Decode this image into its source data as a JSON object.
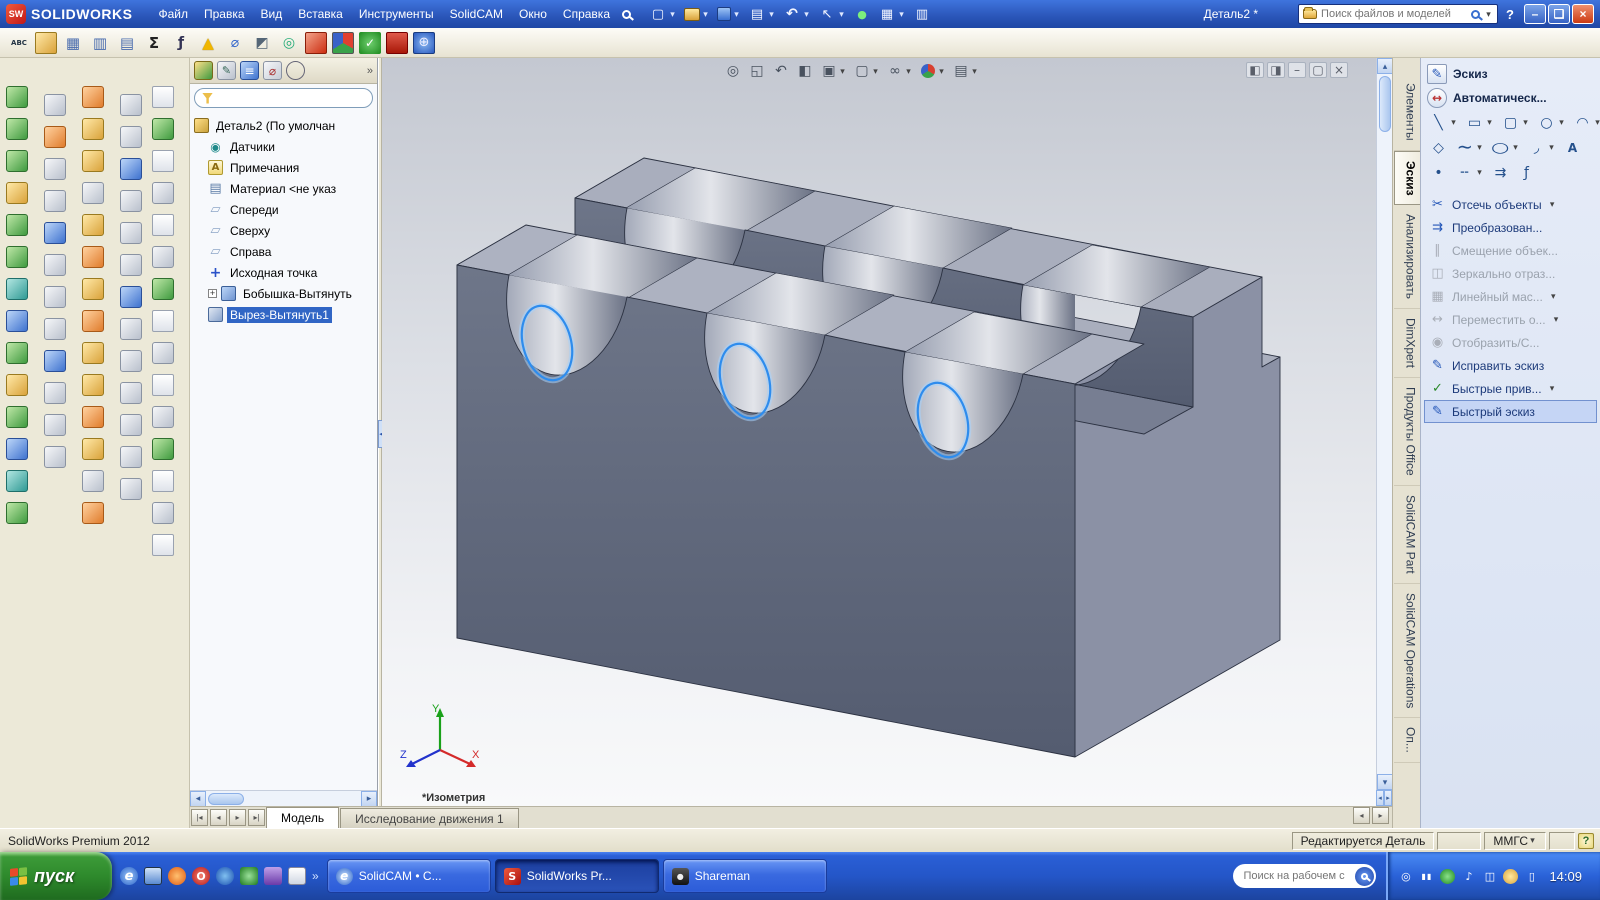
{
  "window": {
    "brand": "SOLIDWORKS",
    "title": "Деталь2 *",
    "files_search_placeholder": "Поиск файлов и моделей"
  },
  "menubar": {
    "items": [
      "Файл",
      "Правка",
      "Вид",
      "Вставка",
      "Инструменты",
      "SolidCAM",
      "Окно",
      "Справка"
    ],
    "tool_icons": [
      {
        "icon": "new-document",
        "dropdown": true
      },
      {
        "icon": "open",
        "dropdown": true
      },
      {
        "icon": "save",
        "dropdown": true
      },
      {
        "icon": "print",
        "dropdown": true
      },
      {
        "icon": "undo",
        "dropdown": true
      },
      {
        "icon": "select",
        "dropdown": true
      },
      {
        "icon": "rebuild",
        "dropdown": false
      },
      {
        "icon": "options",
        "dropdown": true
      },
      {
        "icon": "file-properties",
        "dropdown": false
      }
    ]
  },
  "toolbar2": {
    "icons": [
      "spellcheck",
      "design-library",
      "grid-system",
      "hole-table",
      "bom",
      "sigma",
      "equations",
      "warning",
      "measure",
      "section-props",
      "sensor2",
      "solidcam-simulate",
      "solidcam-tool",
      "solidcam-check",
      "solidcam-stop",
      "solidcam-web"
    ]
  },
  "left_dock": {
    "columns": [
      [
        "g",
        "g",
        "g",
        "y",
        "g",
        "g",
        "t",
        "b",
        "g",
        "y",
        "g",
        "b",
        "t",
        "g"
      ],
      [
        "gr",
        "o",
        "gr",
        "gr",
        "b",
        "gr",
        "gr",
        "gr",
        "b",
        "gr",
        "gr",
        "gr"
      ],
      [
        "o",
        "y",
        "y",
        "gr",
        "y",
        "o",
        "y",
        "o",
        "y",
        "y",
        "o",
        "y",
        "gr",
        "o"
      ],
      [
        "gr",
        "gr",
        "b",
        "gr",
        "gr",
        "gr",
        "b",
        "gr",
        "gr",
        "gr",
        "gr",
        "gr",
        "gr"
      ],
      [
        "w",
        "g",
        "w",
        "gr",
        "w",
        "gr",
        "g",
        "w",
        "gr",
        "w",
        "gr",
        "g",
        "w",
        "gr",
        "w"
      ]
    ]
  },
  "feature_manager": {
    "tabs": [
      {
        "icon": "featuremanager"
      },
      {
        "icon": "propertymanager"
      },
      {
        "icon": "configurationmanager"
      },
      {
        "icon": "dimxpertmanager"
      },
      {
        "icon": "displaymanager"
      }
    ],
    "tree": [
      {
        "label": "Деталь2  (По умолчан",
        "icon": "part"
      },
      {
        "label": "Датчики",
        "icon": "sensors",
        "lvl1": true
      },
      {
        "label": "Примечания",
        "icon": "annotations",
        "lvl1": true
      },
      {
        "label": "Материал <не указ",
        "icon": "material",
        "lvl1": true
      },
      {
        "label": "Спереди",
        "icon": "plane",
        "lvl1": true
      },
      {
        "label": "Сверху",
        "icon": "plane",
        "lvl1": true
      },
      {
        "label": "Справа",
        "icon": "plane",
        "lvl1": true
      },
      {
        "label": "Исходная точка",
        "icon": "origin",
        "lvl1": true
      },
      {
        "label": "Бобышка-Вытянуть",
        "icon": "boss-extrude",
        "lvl1": true,
        "expand": true
      },
      {
        "label": "Вырез-Вытянуть1",
        "icon": "cut-extrude",
        "lvl1": true,
        "selected": true
      }
    ]
  },
  "viewport": {
    "view_label": "*Изометрия",
    "triad": {
      "x": "X",
      "y": "Y",
      "z": "Z"
    },
    "headsup": [
      {
        "icon": "zoom-fit"
      },
      {
        "icon": "zoom-area"
      },
      {
        "icon": "previous-view"
      },
      {
        "icon": "section-view"
      },
      {
        "icon": "view-orientation",
        "dropdown": true
      },
      {
        "icon": "display-style",
        "dropdown": true
      },
      {
        "icon": "hide-show-items",
        "dropdown": true
      },
      {
        "icon": "edit-appearance",
        "dropdown": true
      },
      {
        "icon": "apply-scene",
        "dropdown": true
      }
    ],
    "window_buttons": [
      {
        "icon": "split-horizontal"
      },
      {
        "icon": "split-vertical"
      },
      {
        "icon": "minimize"
      },
      {
        "icon": "restore"
      },
      {
        "icon": "close-x"
      }
    ]
  },
  "bottom_tabs": {
    "nav": [
      {
        "icon": "first"
      },
      {
        "icon": "prev"
      },
      {
        "icon": "next"
      },
      {
        "icon": "last"
      }
    ],
    "tabs": [
      {
        "label": "Модель",
        "active": true
      },
      {
        "label": "Исследование движения 1"
      }
    ]
  },
  "statusbar": {
    "left": "SolidWorks Premium 2012",
    "editing": "Редактируется Деталь",
    "units": "ММГС",
    "help": "?"
  },
  "command_manager": {
    "tabs": [
      {
        "label": "Элементы"
      },
      {
        "label": "Эскиз",
        "active": true
      },
      {
        "label": "Анализировать"
      },
      {
        "label": "DimXpert"
      },
      {
        "label": "Продукты Office"
      },
      {
        "label": "SolidCAM Part"
      },
      {
        "label": "SolidCAM Operations"
      },
      {
        "label": "Оп..."
      }
    ],
    "primary": [
      {
        "label": "Эскиз",
        "icon": "sketch"
      },
      {
        "label": "Автоматическ...",
        "icon": "smart-dimension"
      }
    ],
    "grid_row1": [
      {
        "icon": "line",
        "dropdown": true
      },
      {
        "icon": "corner-rectangle",
        "dropdown": true
      },
      {
        "icon": "straight-slot",
        "dropdown": true
      },
      {
        "icon": "circle",
        "dropdown": true
      },
      {
        "icon": "centerpoint-arc",
        "dropdown": true
      }
    ],
    "grid_row2": [
      {
        "icon": "polygon"
      },
      {
        "icon": "spline",
        "dropdown": true
      },
      {
        "icon": "ellipse",
        "dropdown": true
      },
      {
        "icon": "sketch-fillet",
        "dropdown": true
      },
      {
        "icon": "text"
      }
    ],
    "grid_row3": [
      {
        "icon": "point"
      },
      {
        "icon": "centerline",
        "dropdown": true
      },
      {
        "icon": "convert-entities"
      },
      {
        "icon": "equation"
      }
    ],
    "tools": [
      {
        "label": "Отсечь объекты",
        "icon": "trim",
        "dropdown": true
      },
      {
        "label": "Преобразован...",
        "icon": "convert"
      },
      {
        "label": "Смещение объек...",
        "icon": "offset",
        "disabled": true
      },
      {
        "label": "Зеркально отраз...",
        "icon": "mirror",
        "disabled": true
      },
      {
        "label": "Линейный мас...",
        "icon": "linear-pattern",
        "disabled": true,
        "dropdown": true
      },
      {
        "label": "Переместить о...",
        "icon": "move",
        "disabled": true,
        "dropdown": true
      },
      {
        "label": "Отобразить/С...",
        "icon": "show-hide",
        "disabled": true
      },
      {
        "label": "Исправить эскиз",
        "icon": "repair"
      },
      {
        "label": "Быстрые прив...",
        "icon": "quick-snaps",
        "dropdown": true
      },
      {
        "label": "Быстрый эскиз",
        "icon": "quick-sketch",
        "selected": true
      }
    ]
  },
  "taskbar": {
    "start": "пуск",
    "quick_launch": [
      "ie",
      "desktop",
      "firefox",
      "opera",
      "media",
      "green-app",
      "purple-app",
      "doc-app"
    ],
    "tasks": [
      {
        "label": "SolidCAM • C...",
        "icon": "solidcam"
      },
      {
        "label": "SolidWorks Pr...",
        "icon": "solidworks",
        "active": true
      },
      {
        "label": "Shareman",
        "icon": "shareman"
      }
    ],
    "search_placeholder": "Поиск на рабочем с",
    "tray": [
      "tray-search",
      "tray-signal",
      "tray-shield",
      "tray-volume",
      "tray-network",
      "tray-update",
      "tray-battery"
    ],
    "clock": "14:09"
  }
}
